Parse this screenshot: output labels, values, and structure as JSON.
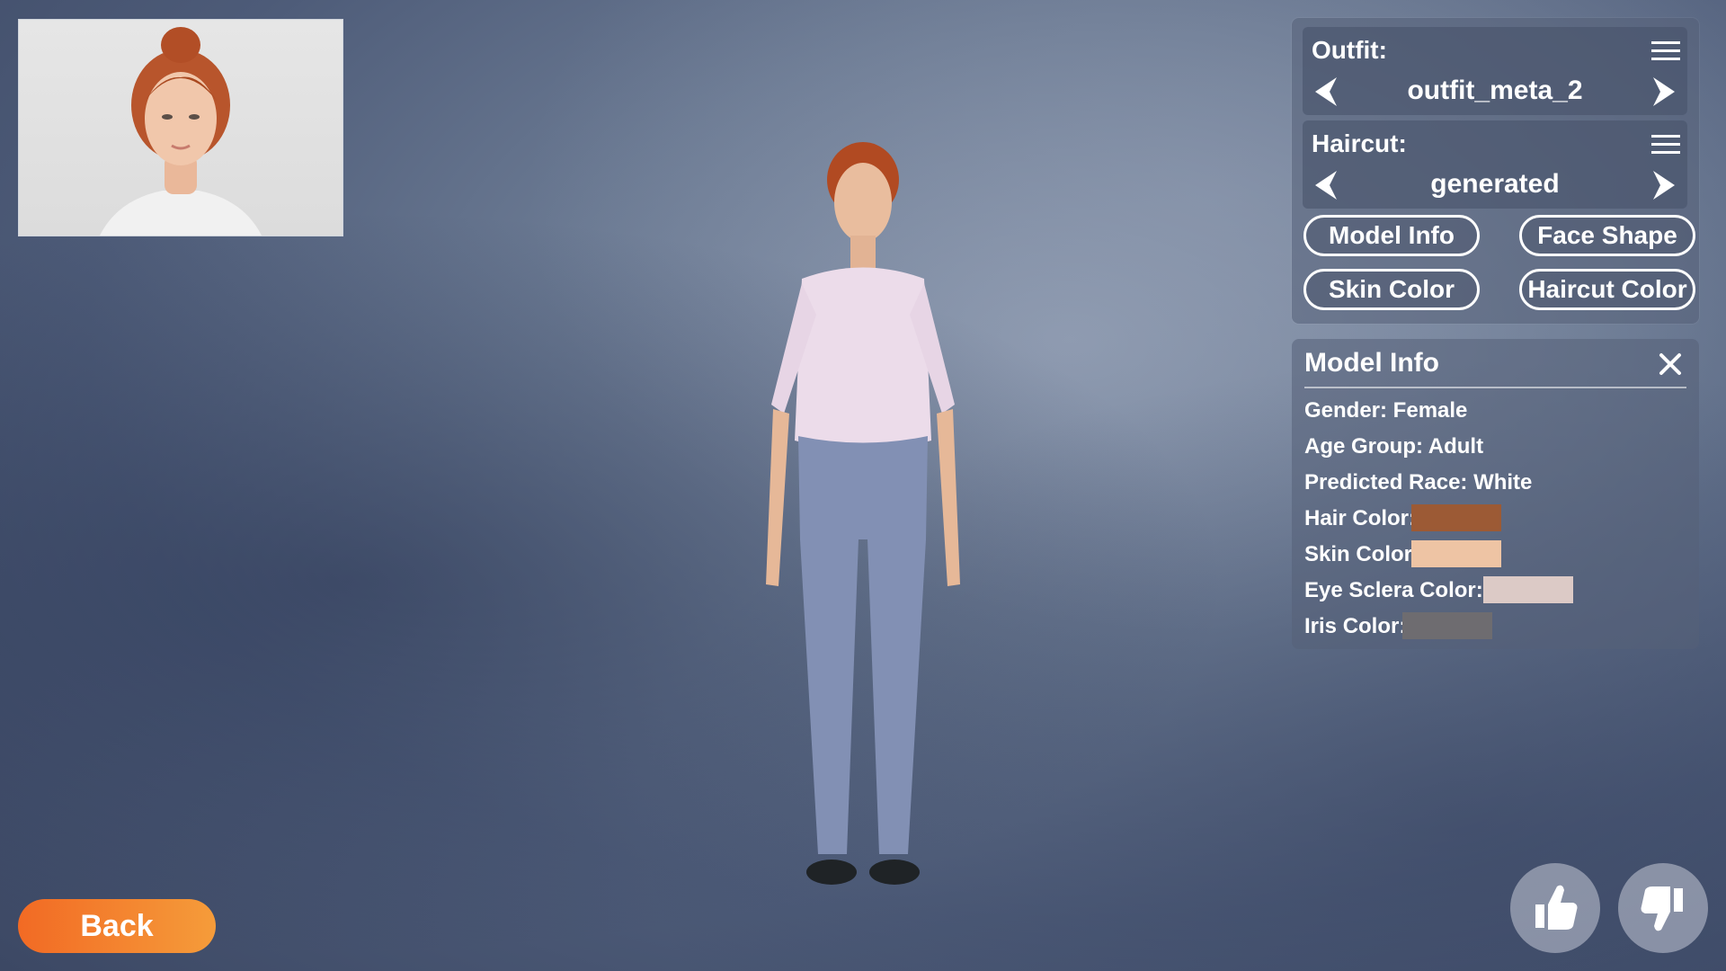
{
  "outfit": {
    "label": "Outfit:",
    "value": "outfit_meta_2"
  },
  "haircut": {
    "label": "Haircut:",
    "value": "generated"
  },
  "buttons": {
    "model_info": "Model Info",
    "face_shape": "Face Shape",
    "skin_color": "Skin Color",
    "haircut_color": "Haircut Color"
  },
  "model_info": {
    "title": "Model Info",
    "gender": "Gender: Female",
    "age_group": "Age Group: Adult",
    "predicted_race": "Predicted Race: White",
    "hair_color_label": "Hair Color:",
    "skin_color_label": "Skin Color:",
    "eye_sclera_color_label": "Eye Sclera Color:",
    "iris_color_label": "Iris Color:"
  },
  "colors": {
    "hair": "#9c5a35",
    "skin": "#eec4a4",
    "eye_sclera": "#dccac6",
    "iris": "#6e6c70",
    "back_button": "#f47a2c"
  },
  "back": {
    "label": "Back"
  },
  "icons": {
    "menu": "hamburger-icon",
    "prev": "chevron-left-icon",
    "next": "chevron-right-icon",
    "close": "close-icon",
    "like": "thumbs-up-icon",
    "dislike": "thumbs-down-icon"
  }
}
